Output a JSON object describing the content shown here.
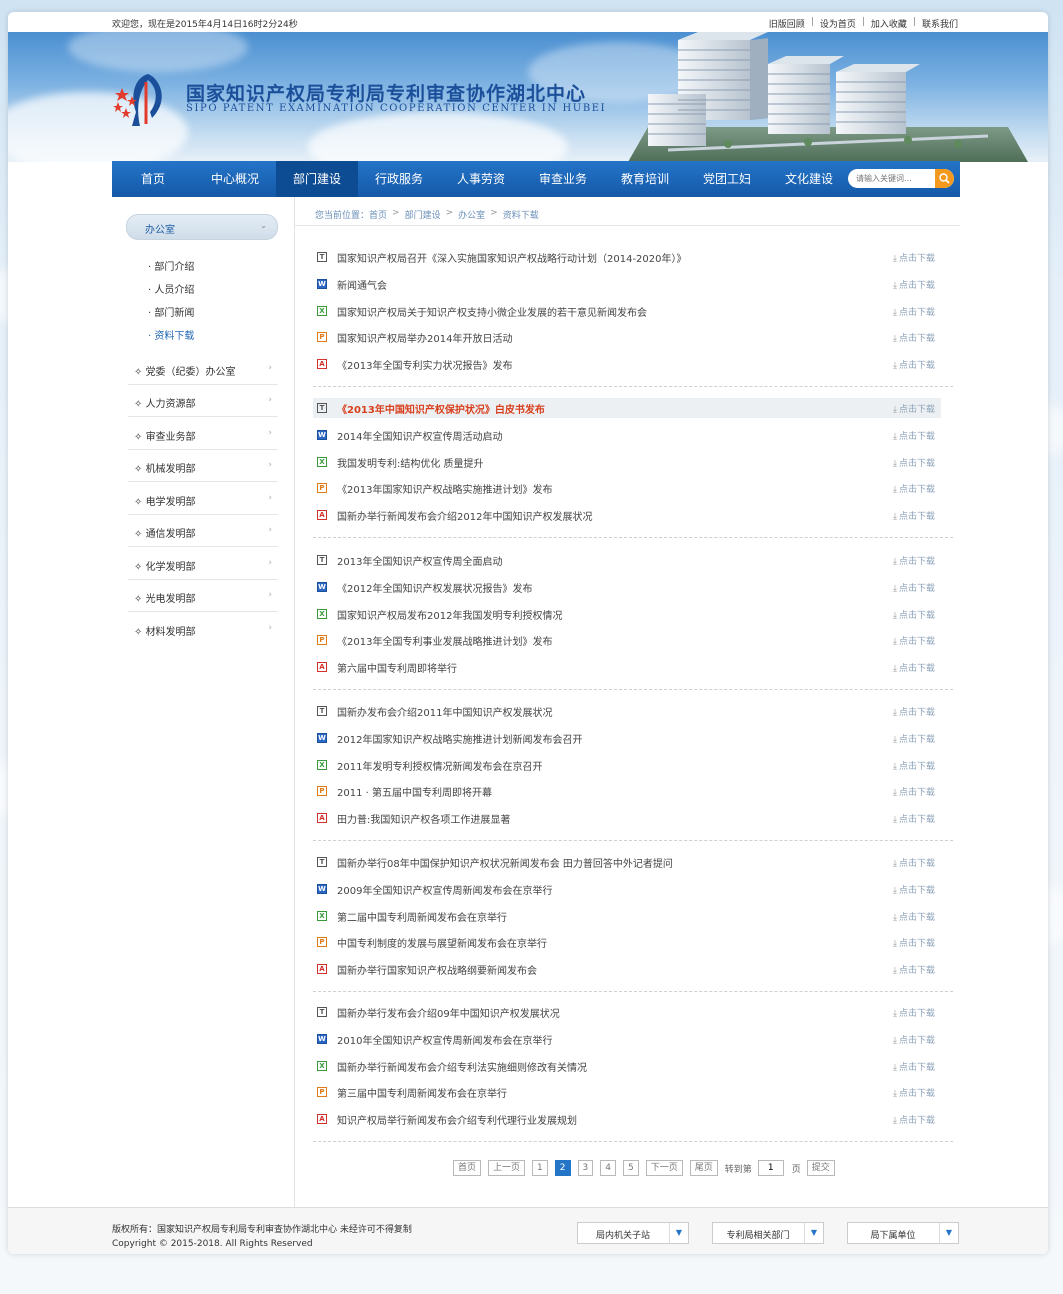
{
  "topbar": {
    "welcome": "欢迎您，现在是2015年4月14日16时2分24秒",
    "links": [
      "旧版回顾",
      "设为首页",
      "加入收藏",
      "联系我们"
    ]
  },
  "brand": {
    "name_cn": "国家知识产权局专利局专利审查协作湖北中心",
    "name_en": "SIPO PATENT EXAMINATION COOPERATION CENTER IN HUBEI"
  },
  "nav": {
    "items": [
      "首页",
      "中心概况",
      "部门建设",
      "行政服务",
      "人事劳资",
      "审查业务",
      "教育培训",
      "党团工妇",
      "文化建设"
    ],
    "active_index": 2,
    "search_placeholder": "请输入关键词..."
  },
  "sidebar": {
    "current": "办公室",
    "sub_items": [
      "部门介绍",
      "人员介绍",
      "部门新闻",
      "资料下载"
    ],
    "current_sub_index": 3,
    "groups": [
      "党委（纪委）办公室",
      "人力资源部",
      "审查业务部",
      "机械发明部",
      "电学发明部",
      "通信发明部",
      "化学发明部",
      "光电发明部",
      "材料发明部"
    ]
  },
  "breadcrumb": [
    "您当前位置：",
    "首页",
    "部门建设",
    "办公室",
    "资料下载"
  ],
  "download_label": "点击下载",
  "files": [
    {
      "type": "t",
      "title": "国家知识产权局召开《深入实施国家知识产权战略行动计划（2014-2020年）》"
    },
    {
      "type": "w",
      "title": "新闻通气会"
    },
    {
      "type": "x",
      "title": "国家知识产权局关于知识产权支持小微企业发展的若干意见新闻发布会"
    },
    {
      "type": "p",
      "title": "国家知识产权局举办2014年开放日活动"
    },
    {
      "type": "f",
      "title": "《2013年全国专利实力状况报告》发布"
    },
    {
      "type": "t",
      "title": "《2013年中国知识产权保护状况》白皮书发布",
      "highlight": true
    },
    {
      "type": "w",
      "title": "2014年全国知识产权宣传周活动启动"
    },
    {
      "type": "x",
      "title": "我国发明专利:结构优化 质量提升"
    },
    {
      "type": "p",
      "title": "《2013年国家知识产权战略实施推进计划》发布"
    },
    {
      "type": "f",
      "title": "国新办举行新闻发布会介绍2012年中国知识产权发展状况"
    },
    {
      "type": "t",
      "title": "2013年全国知识产权宣传周全面启动"
    },
    {
      "type": "w",
      "title": "《2012年全国知识产权发展状况报告》发布"
    },
    {
      "type": "x",
      "title": "国家知识产权局发布2012年我国发明专利授权情况"
    },
    {
      "type": "p",
      "title": "《2013年全国专利事业发展战略推进计划》发布"
    },
    {
      "type": "f",
      "title": "第六届中国专利周即将举行"
    },
    {
      "type": "t",
      "title": "国新办发布会介绍2011年中国知识产权发展状况"
    },
    {
      "type": "w",
      "title": "2012年国家知识产权战略实施推进计划新闻发布会召开"
    },
    {
      "type": "x",
      "title": "2011年发明专利授权情况新闻发布会在京召开"
    },
    {
      "type": "p",
      "title": "2011 · 第五届中国专利周即将开幕"
    },
    {
      "type": "f",
      "title": "田力普:我国知识产权各项工作进展显著"
    },
    {
      "type": "t",
      "title": "国新办举行08年中国保护知识产权状况新闻发布会 田力普回答中外记者提问"
    },
    {
      "type": "w",
      "title": "2009年全国知识产权宣传周新闻发布会在京举行"
    },
    {
      "type": "x",
      "title": "第二届中国专利周新闻发布会在京举行"
    },
    {
      "type": "p",
      "title": "中国专利制度的发展与展望新闻发布会在京举行"
    },
    {
      "type": "f",
      "title": "国新办举行国家知识产权战略纲要新闻发布会"
    },
    {
      "type": "t",
      "title": "国新办举行发布会介绍09年中国知识产权发展状况"
    },
    {
      "type": "w",
      "title": "2010年全国知识产权宣传周新闻发布会在京举行"
    },
    {
      "type": "x",
      "title": "国新办举行新闻发布会介绍专利法实施细则修改有关情况"
    },
    {
      "type": "p",
      "title": "第三届中国专利周新闻发布会在京举行"
    },
    {
      "type": "f",
      "title": "知识产权局举行新闻发布会介绍专利代理行业发展规划"
    }
  ],
  "pager": {
    "first": "首页",
    "prev": "上一页",
    "pages": [
      "1",
      "2",
      "3",
      "4",
      "5"
    ],
    "current": "2",
    "next": "下一页",
    "last": "尾页",
    "goto_label": "转到第",
    "goto_value": "1",
    "page_unit": "页",
    "submit": "提交"
  },
  "footer": {
    "copyright": "版权所有：国家知识产权局专利局专利审查协作湖北中心  未经许可不得复制",
    "copyright_en": "Copyright © 2015-2018. All Rights Reserved",
    "selects": [
      "局内机关子站",
      "专利局相关部门",
      "局下属单位"
    ]
  },
  "colors": {
    "nav_blue": "#1f6ac0",
    "highlight_red": "#d83f1c",
    "accent_orange": "#f39a1e"
  }
}
